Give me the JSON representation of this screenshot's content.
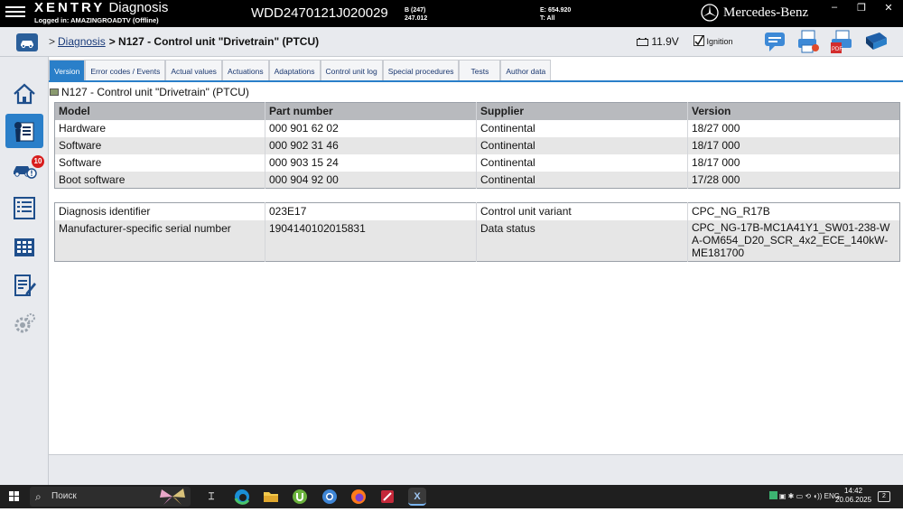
{
  "app": {
    "brand_bold": "XENTRY",
    "brand_rest": "Diagnosis",
    "login": "Logged in: AMAZINGROADTV (Offline)",
    "vin": "WDD2470121J020029",
    "model_line1": "B (247)",
    "model_line2": "247.012",
    "e_line": "E: 654.920",
    "t_line": "T: All",
    "maker": "Mercedes-Benz",
    "window_controls": [
      "–",
      "❐",
      "✕"
    ]
  },
  "header": {
    "breadcrumb_link": "Diagnosis",
    "breadcrumb_sep": ">",
    "breadcrumb_current": "> N127 - Control unit \"Drivetrain\" (PTCU)",
    "voltage": "11.9V",
    "ignition": "Ignition",
    "icons": [
      "chat-icon",
      "print-preview-icon",
      "pdf-print-icon",
      "manual-book-icon"
    ]
  },
  "sidebar": {
    "items": [
      "home-icon",
      "diagnosis-report-icon",
      "vehicle-warning-icon",
      "list-icon",
      "control-units-grid-icon",
      "edit-document-icon",
      "settings-gears-icon"
    ],
    "badge": "10"
  },
  "tabs": [
    {
      "label": "Version",
      "active": true
    },
    {
      "label": "Error codes / Events"
    },
    {
      "label": "Actual values"
    },
    {
      "label": "Actuations"
    },
    {
      "label": "Adaptations"
    },
    {
      "label": "Control unit log"
    },
    {
      "label": "Special procedures"
    },
    {
      "label": "Tests"
    },
    {
      "label": "Author data"
    }
  ],
  "panel_title": "N127 - Control unit \"Drivetrain\" (PTCU)",
  "version_table": {
    "headers": [
      "Model",
      "Part number",
      "Supplier",
      "Version"
    ],
    "rows": [
      [
        "Hardware",
        "000 901 62 02",
        "Continental",
        "18/27 000"
      ],
      [
        "Software",
        "000 902 31 46",
        "Continental",
        "18/17 000"
      ],
      [
        "Software",
        "000 903 15 24",
        "Continental",
        "18/17 000"
      ],
      [
        "Boot software",
        "000 904 92 00",
        "Continental",
        "17/28 000"
      ]
    ]
  },
  "info_table": {
    "rows": [
      [
        "Diagnosis identifier",
        "023E17",
        "Control unit variant",
        "CPC_NG_R17B"
      ],
      [
        "Manufacturer-specific serial number",
        "1904140102015831",
        "Data status",
        "CPC_NG-17B-MC1A41Y1_SW01-238-WA-OM654_D20_SCR_4x2_ECE_140kW-ME181700"
      ]
    ]
  },
  "taskbar": {
    "search_placeholder": "Поиск",
    "apps": [
      "task-view-icon",
      "edge-icon",
      "file-explorer-icon",
      "utorrent-icon",
      "chrome-like-icon",
      "firefox-icon",
      "teamviewer-icon",
      "xentry-icon"
    ],
    "language": "ENG",
    "time": "14:42",
    "date": "20.06.2025",
    "notifications": "2"
  },
  "colors": {
    "accent": "#2a7fc9",
    "topbar": "#000000",
    "badge": "#d81e1e",
    "table_header": "#b8babe"
  }
}
